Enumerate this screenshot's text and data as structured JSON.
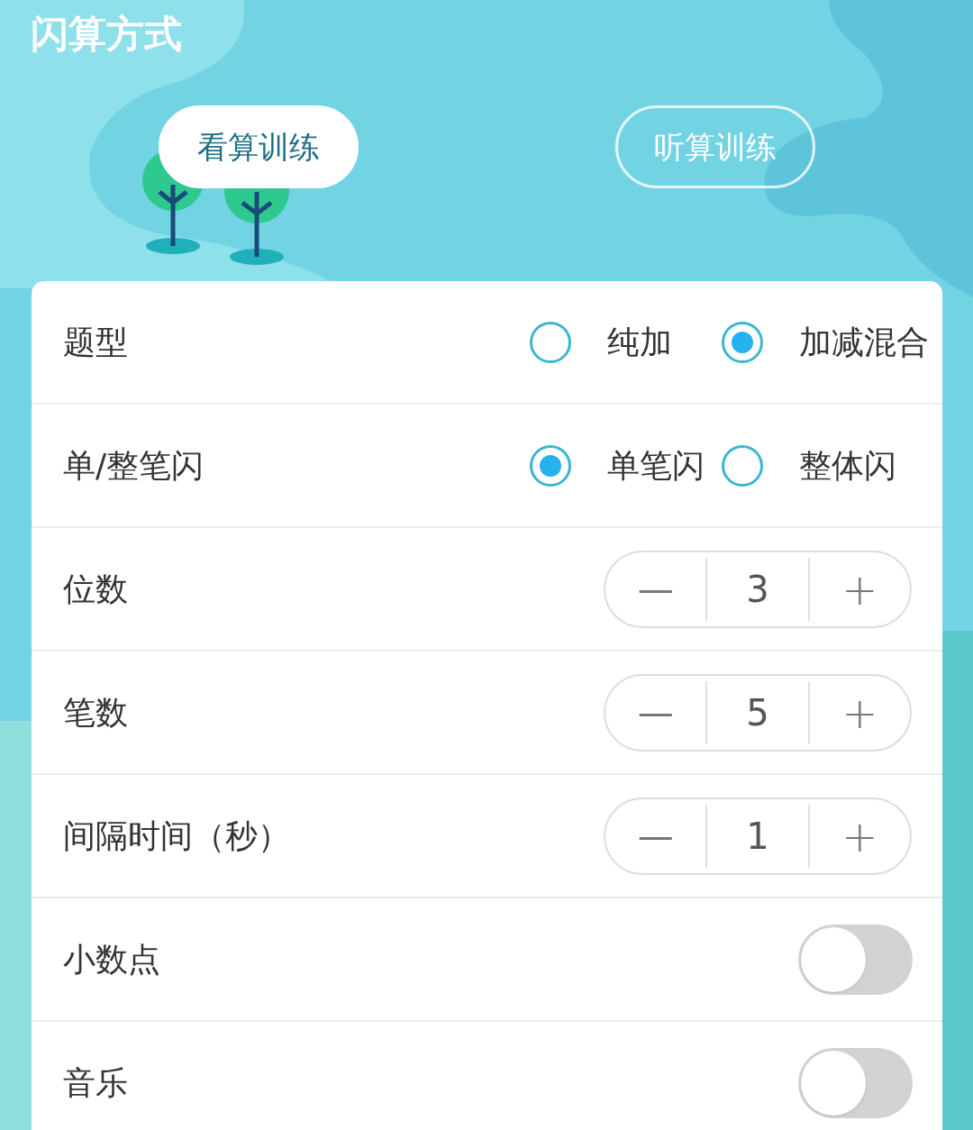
{
  "title": "闪算方式",
  "modes": [
    {
      "label": "看算训练",
      "selected": true
    },
    {
      "label": "听算训练",
      "selected": false
    }
  ],
  "settings": [
    {
      "kind": "radio",
      "label": "题型",
      "options": [
        {
          "label": "纯加",
          "selected": false
        },
        {
          "label": "加减混合",
          "selected": true
        }
      ]
    },
    {
      "kind": "radio",
      "label": "单/整笔闪",
      "options": [
        {
          "label": "单笔闪",
          "selected": true
        },
        {
          "label": "整体闪",
          "selected": false
        }
      ]
    },
    {
      "kind": "stepper",
      "label": "位数",
      "minus": "—",
      "value": "3",
      "plus": "+"
    },
    {
      "kind": "stepper",
      "label": "笔数",
      "minus": "—",
      "value": "5",
      "plus": "+"
    },
    {
      "kind": "stepper",
      "label": "间隔时间（秒）",
      "minus": "—",
      "value": "1",
      "plus": "+"
    },
    {
      "kind": "toggle",
      "label": "小数点",
      "on": false
    },
    {
      "kind": "toggle",
      "label": "音乐",
      "on": false
    }
  ]
}
